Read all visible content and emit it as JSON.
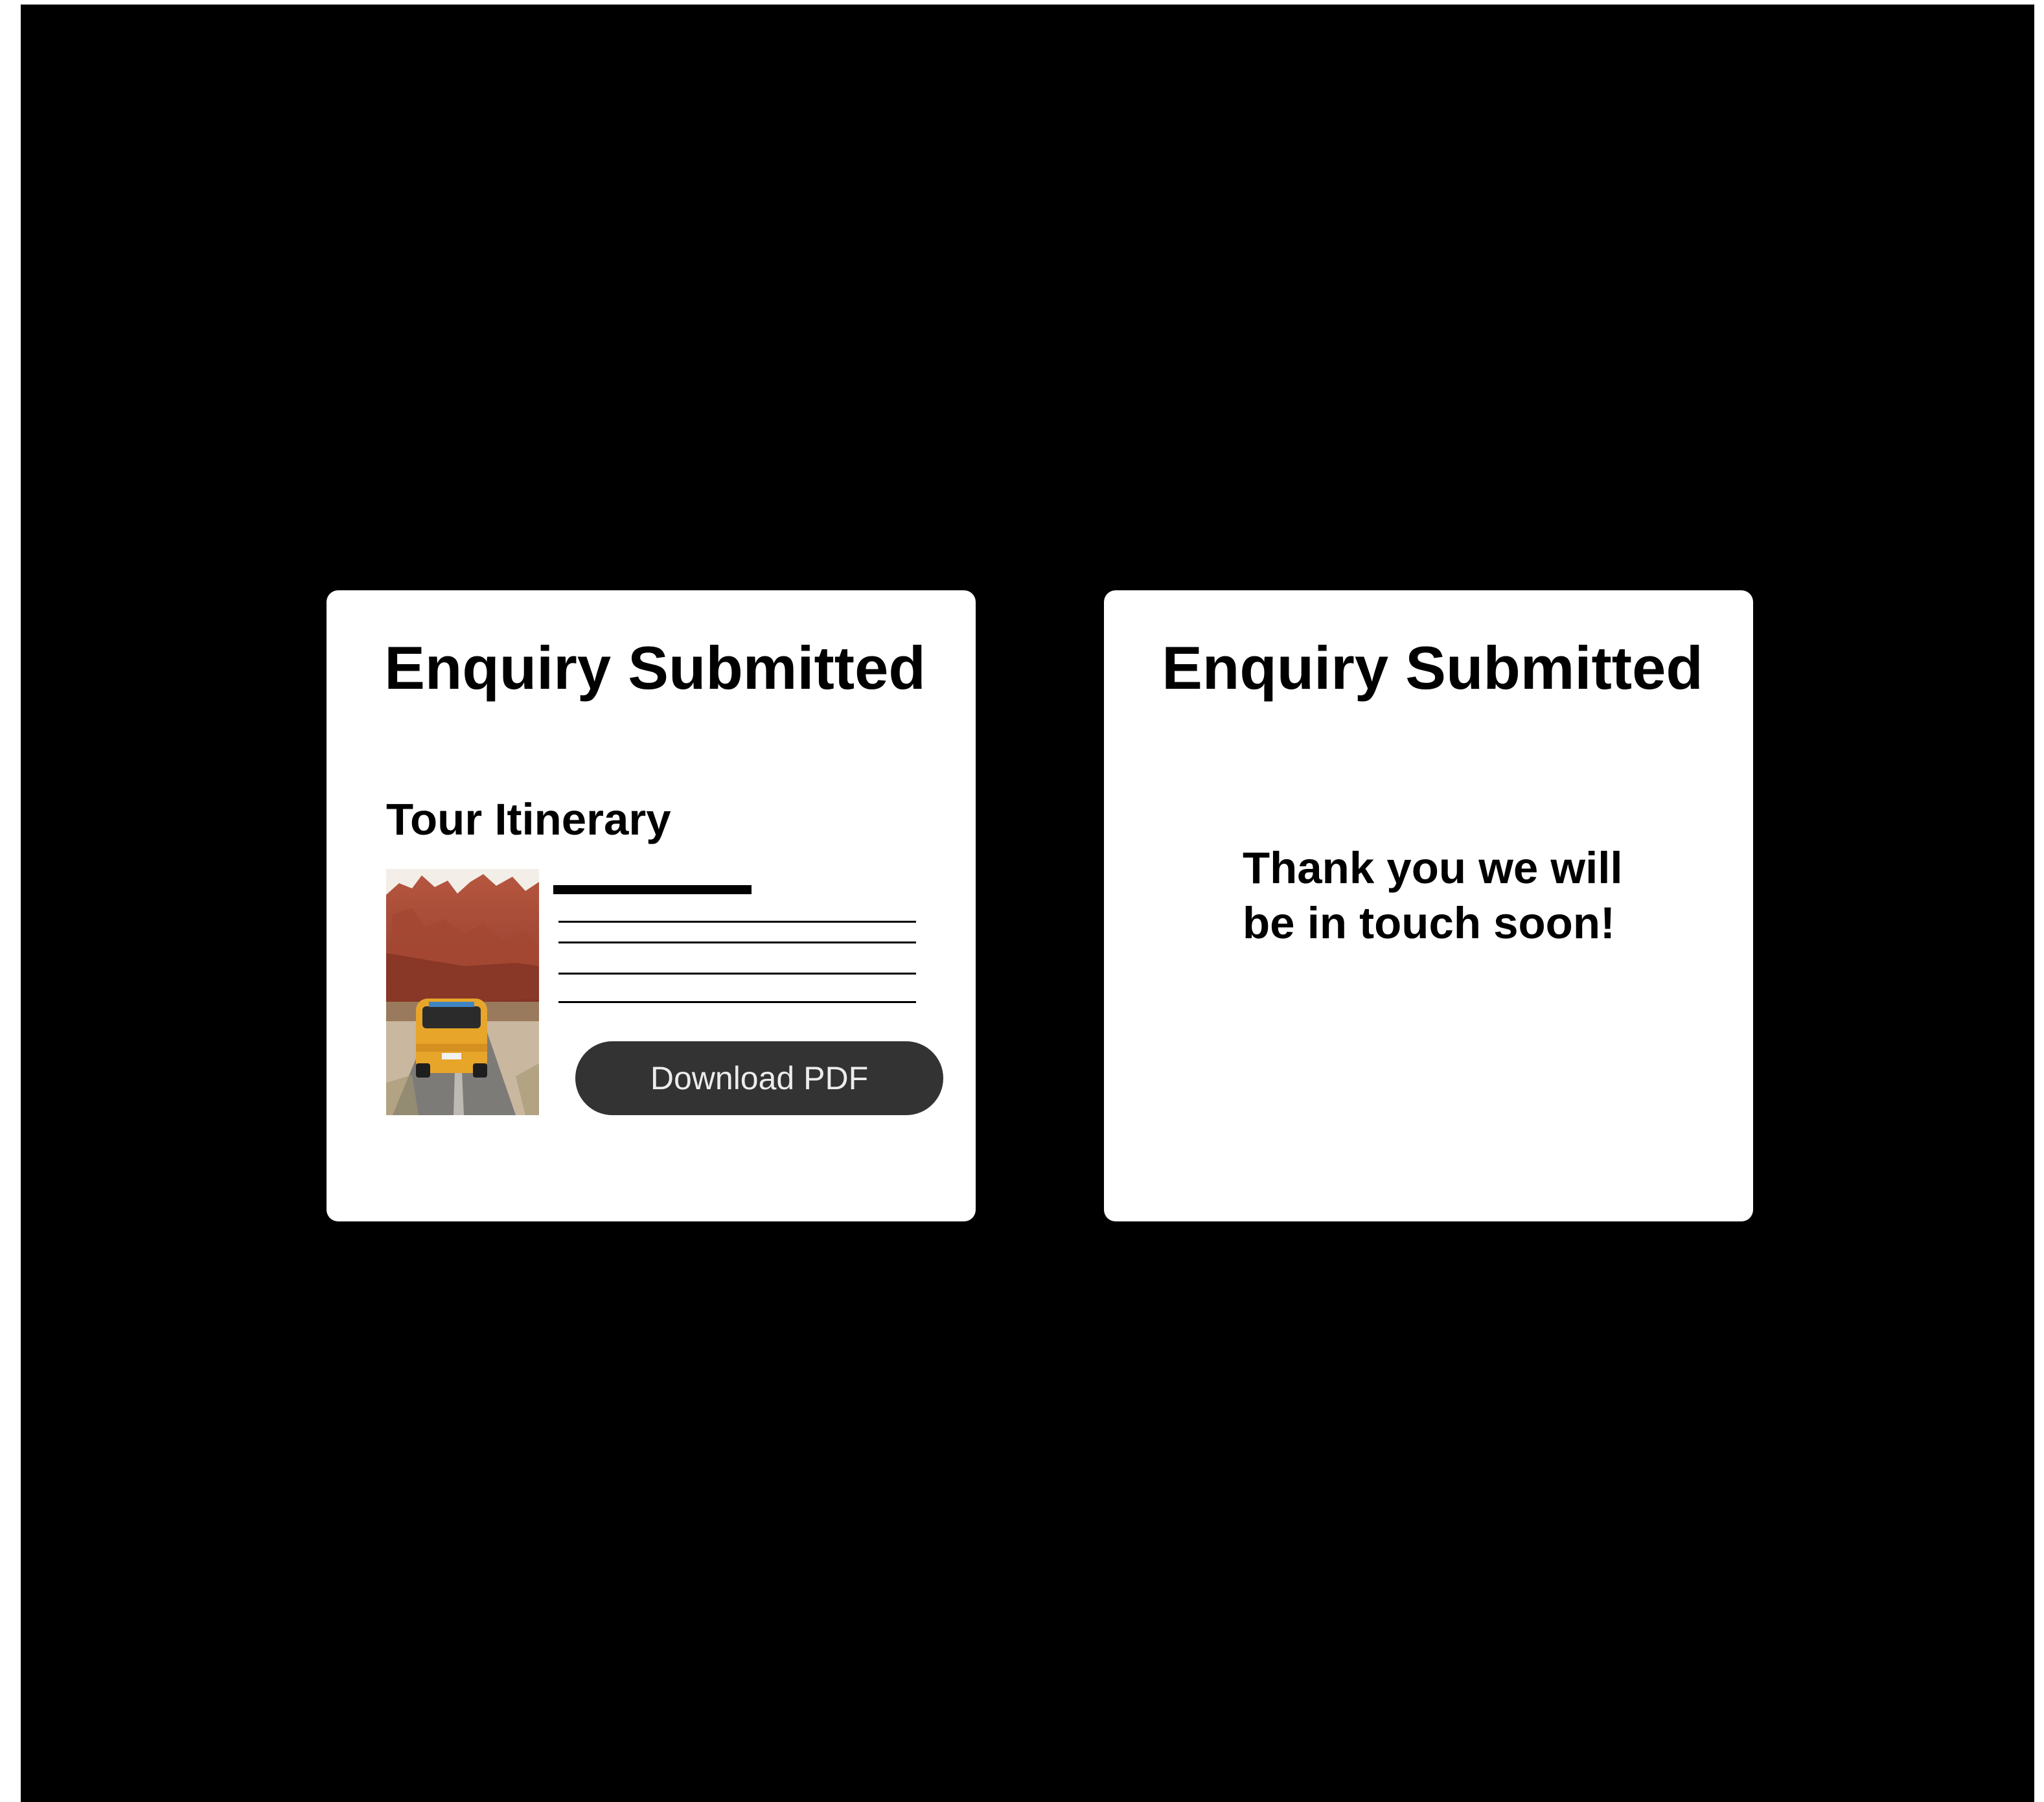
{
  "colors": {
    "background": "#000000",
    "card": "#ffffff",
    "button": "#333333",
    "button_text": "#ececec"
  },
  "left_card": {
    "title": "Enquiry Submitted",
    "section_title": "Tour Itinerary",
    "thumbnail": "canyon-road-van-photo",
    "download_label": "Download PDF"
  },
  "right_card": {
    "title": "Enquiry Submitted",
    "message_line1": "Thank you we will",
    "message_line2": "be in touch soon!"
  }
}
